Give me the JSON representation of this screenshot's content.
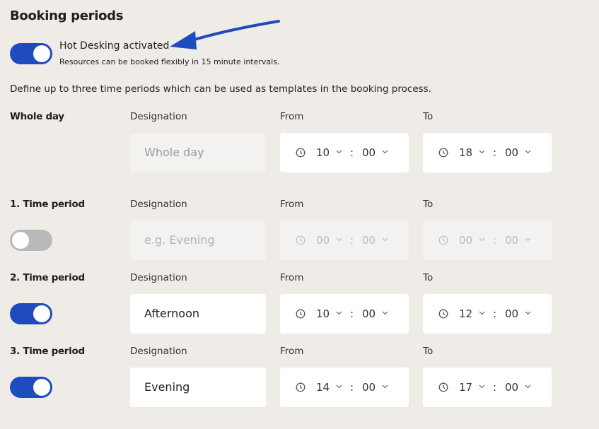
{
  "section": {
    "title": "Booking periods"
  },
  "hot_desking": {
    "label": "Hot Desking activated",
    "description": "Resources can be booked flexibly in 15 minute intervals.",
    "enabled": true
  },
  "intro": "Define up to three time periods which can be used as templates in the booking process.",
  "columns": {
    "designation": "Designation",
    "from": "From",
    "to": "To"
  },
  "periods": [
    {
      "label": "Whole day",
      "designation": "",
      "placeholder": "Whole day",
      "from_h": "10",
      "from_m": "00",
      "to_h": "18",
      "to_m": "00"
    },
    {
      "label": "1. Time period",
      "enabled": false,
      "designation": "",
      "placeholder": "e.g. Evening",
      "from_h": "00",
      "from_m": "00",
      "to_h": "00",
      "to_m": "00"
    },
    {
      "label": "2. Time period",
      "enabled": true,
      "designation": "Afternoon",
      "from_h": "10",
      "from_m": "00",
      "to_h": "12",
      "to_m": "00"
    },
    {
      "label": "3. Time period",
      "enabled": true,
      "designation": "Evening",
      "from_h": "14",
      "from_m": "00",
      "to_h": "17",
      "to_m": "00"
    }
  ],
  "colors": {
    "accent": "#1e4bbf",
    "toggle_off": "#b9b9b9",
    "background": "#efebe7",
    "annotation_arrow": "#1e4bbf"
  },
  "icons": {
    "time": "clock-icon",
    "dropdown": "chevron-down-icon",
    "annotation": "arrow-annotation"
  }
}
